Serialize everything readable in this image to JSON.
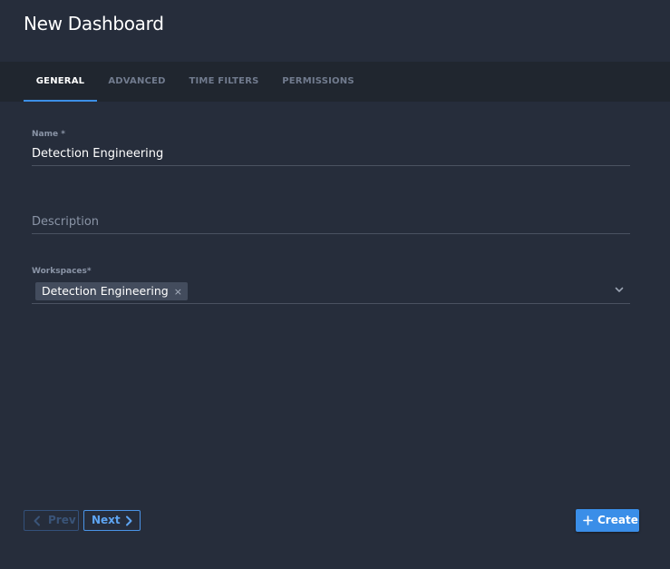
{
  "dialog": {
    "title": "New Dashboard"
  },
  "tabs": [
    {
      "label": "GENERAL",
      "active": true
    },
    {
      "label": "ADVANCED",
      "active": false
    },
    {
      "label": "TIME FILTERS",
      "active": false
    },
    {
      "label": "PERMISSIONS",
      "active": false
    }
  ],
  "form": {
    "name": {
      "label": "Name *",
      "value": "Detection Engineering"
    },
    "description": {
      "placeholder": "Description"
    },
    "workspaces": {
      "label": "Workspaces*",
      "selected": [
        {
          "label": "Detection Engineering"
        }
      ],
      "remove_glyph": "×"
    }
  },
  "footer": {
    "prev_label": "Prev",
    "next_label": "Next",
    "create_label": "Create"
  },
  "colors": {
    "background": "#262d3b",
    "tab_bar": "#20262f",
    "accent": "#3a8ee8",
    "muted_text": "#8a94a6",
    "chip": "#434c5d"
  }
}
